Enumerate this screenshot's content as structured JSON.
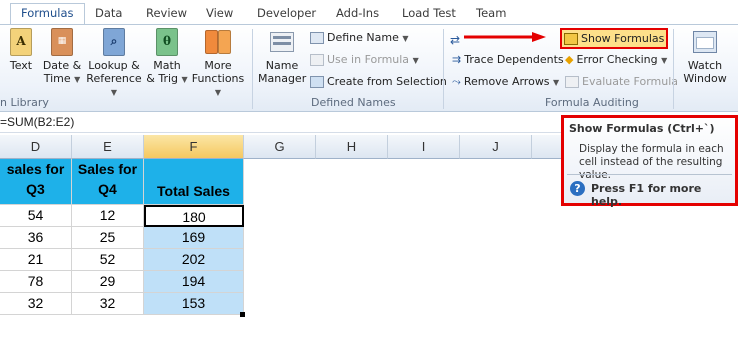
{
  "tabs": [
    "Formulas",
    "Data",
    "Review",
    "View",
    "Developer",
    "Add-Ins",
    "Load Test",
    "Team"
  ],
  "ribbon": {
    "function_library": {
      "text": "Text",
      "date_time": [
        "Date &",
        "Time"
      ],
      "lookup": [
        "Lookup &",
        "Reference"
      ],
      "math": [
        "Math",
        "& Trig"
      ],
      "more": [
        "More",
        "Functions"
      ],
      "group_label": "n Library"
    },
    "defined_names": {
      "name_manager": [
        "Name",
        "Manager"
      ],
      "define_name": "Define Name",
      "use_in_formula": "Use in Formula",
      "create_from_selection": "Create from Selection",
      "group_label": "Defined Names"
    },
    "formula_auditing": {
      "show_formulas": "Show Formulas",
      "trace_dependents": "Trace Dependents",
      "error_checking": "Error Checking",
      "remove_arrows": "Remove Arrows",
      "evaluate_formula": "Evaluate Formula",
      "watch_window": [
        "Watch",
        "Window"
      ],
      "group_label": "Formula Auditing"
    }
  },
  "formula_bar": {
    "text": "=SUM(B2:E2)"
  },
  "columns": [
    "D",
    "E",
    "F",
    "G",
    "H",
    "I",
    "J"
  ],
  "headers": {
    "d": [
      "sales for",
      "Q3"
    ],
    "e": [
      "Sales for",
      "Q4"
    ],
    "f": "Total Sales"
  },
  "rows": [
    {
      "d": "54",
      "e": "12",
      "f": "180"
    },
    {
      "d": "36",
      "e": "25",
      "f": "169"
    },
    {
      "d": "21",
      "e": "52",
      "f": "202"
    },
    {
      "d": "78",
      "e": "29",
      "f": "194"
    },
    {
      "d": "32",
      "e": "32",
      "f": "153"
    }
  ],
  "tooltip": {
    "title": "Show Formulas (Ctrl+`)",
    "body": "Display the formula in each cell instead of the resulting value.",
    "help": "Press F1 for more help."
  },
  "colors": {
    "header_fill": "#1eb1e9",
    "selection_fill": "#bfe0f8",
    "highlight_border": "#e40000",
    "arrow": "#e40000"
  }
}
